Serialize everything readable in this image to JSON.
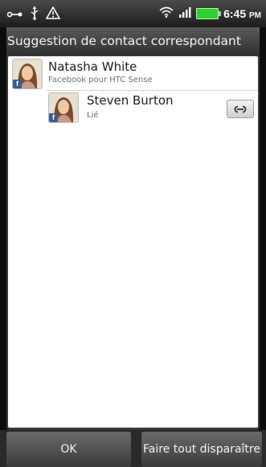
{
  "status_bar": {
    "time": "6:45",
    "ampm": "PM",
    "icons": [
      "usb-connection-icon",
      "usb-icon",
      "warning-icon",
      "wifi-icon",
      "signal-icon",
      "battery-icon"
    ]
  },
  "dialog": {
    "title": "Suggestion de contact correspondant",
    "contacts": [
      {
        "name": "Natasha White",
        "subtitle": "Facebook pour HTC Sense"
      },
      {
        "name": "Steven Burton",
        "subtitle": "Lié"
      }
    ]
  },
  "buttons": {
    "ok": "OK",
    "dismiss_all": "Faire tout disparaître"
  },
  "colors": {
    "facebook_blue": "#3b5998",
    "battery_green": "#2fd12f"
  }
}
